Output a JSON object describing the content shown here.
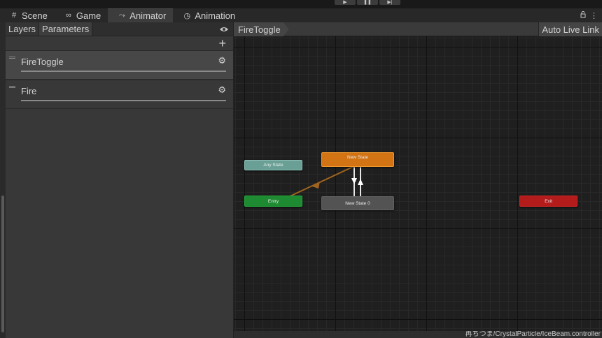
{
  "toolbar": {
    "play_icon": "▶",
    "pause_icon": "❚❚",
    "step_icon": "▶|"
  },
  "tabs": [
    {
      "label": "Scene",
      "icon": "#"
    },
    {
      "label": "Game",
      "icon": "∞"
    },
    {
      "label": "Animator",
      "icon": "⤳"
    },
    {
      "label": "Animation",
      "icon": "◷"
    }
  ],
  "tab_actions": {
    "lock_icon": "🔒",
    "menu_icon": "⋮"
  },
  "left_panel": {
    "subtabs": [
      {
        "label": "Layers"
      },
      {
        "label": "Parameters"
      }
    ],
    "eye_icon": "👁",
    "add_icon": "+",
    "parameters": [
      {
        "name": "FireToggle",
        "gear_icon": "⚙"
      },
      {
        "name": "Fire",
        "gear_icon": "⚙"
      }
    ]
  },
  "graph": {
    "breadcrumb": "FireToggle",
    "auto_live_link": "Auto Live Link",
    "nodes": {
      "any_state": "Any State",
      "entry": "Entry",
      "exit": "Exit",
      "new_state": "New State",
      "new_state_0": "New State 0"
    },
    "status_path": "再ちつま/CrystalParticle/IceBeam.controller"
  },
  "colors": {
    "any_state": "#6a9f95",
    "entry": "#1e8a32",
    "exit": "#b41b1b",
    "default_state": "#d27314",
    "state": "#535353",
    "transition_default": "#a0641e",
    "transition": "#e6e6e6"
  }
}
